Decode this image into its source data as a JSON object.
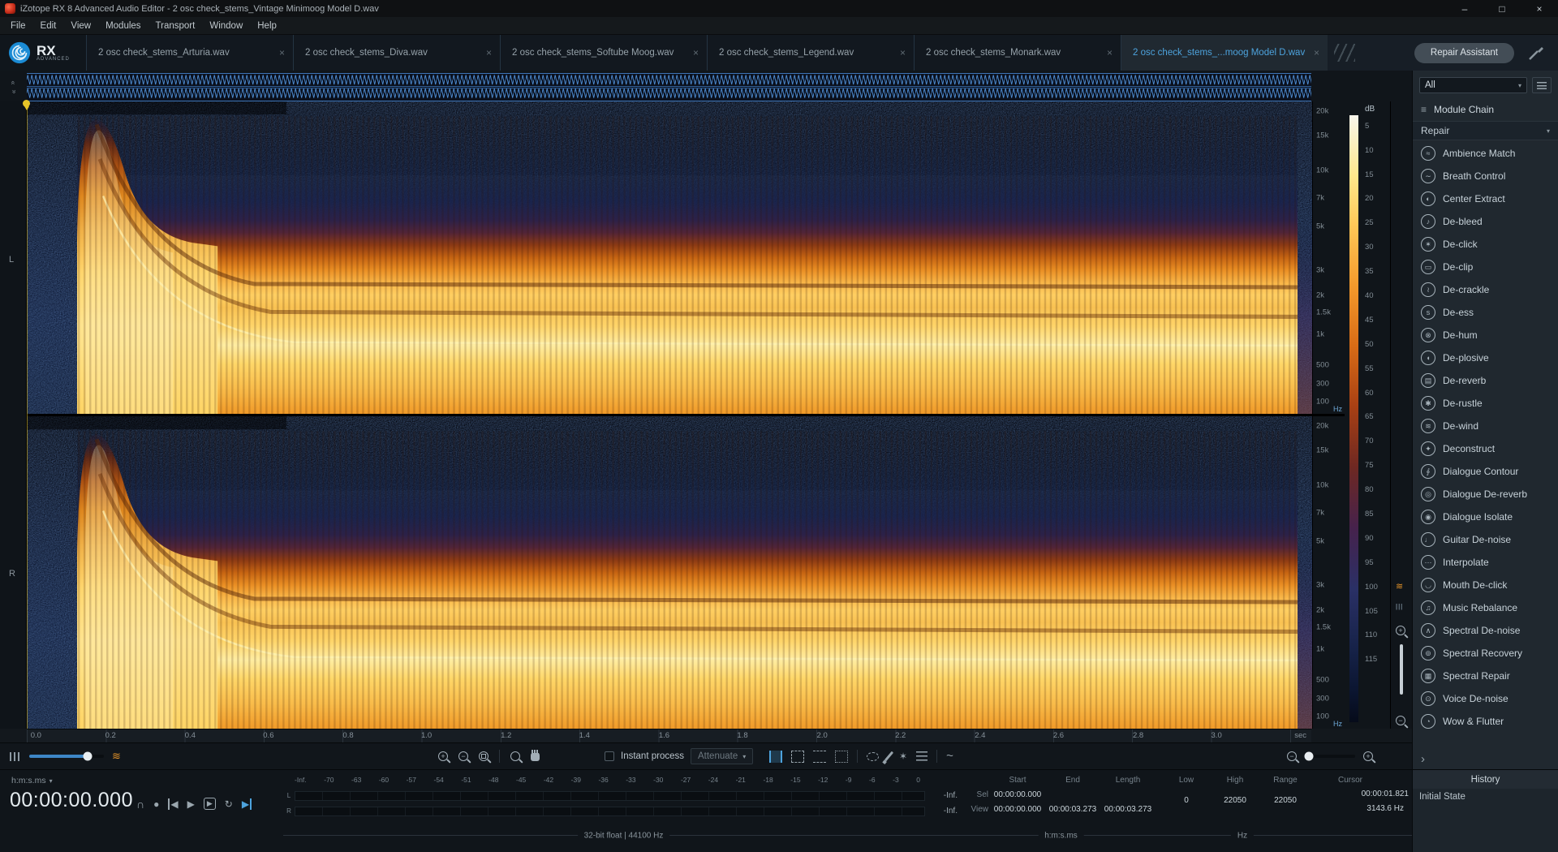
{
  "titlebar": {
    "title": "iZotope RX 8 Advanced Audio Editor - 2 osc check_stems_Vintage Minimoog Model D.wav",
    "minimize": "–",
    "maximize": "□",
    "close": "×"
  },
  "menubar": {
    "items": [
      "File",
      "Edit",
      "View",
      "Modules",
      "Transport",
      "Window",
      "Help"
    ]
  },
  "brand": {
    "product": "RX",
    "edition": "ADVANCED"
  },
  "tabbar": {
    "tabs": [
      {
        "label": "2 osc check_stems_Arturia.wav",
        "close": "×",
        "active": false
      },
      {
        "label": "2 osc check_stems_Diva.wav",
        "close": "×",
        "active": false
      },
      {
        "label": "2 osc check_stems_Softube Moog.wav",
        "close": "×",
        "active": false
      },
      {
        "label": "2 osc check_stems_Legend.wav",
        "close": "×",
        "active": false
      },
      {
        "label": "2 osc check_stems_Monark.wav",
        "close": "×",
        "active": false
      },
      {
        "label": "2 osc check_stems_...moog Model D.wav",
        "close": "×",
        "active": true
      }
    ],
    "repair_assistant": "Repair Assistant"
  },
  "spectrogram": {
    "channel_labels": [
      "L",
      "R"
    ],
    "freq_ticks": [
      "20k",
      "15k",
      "10k",
      "7k",
      "5k",
      "3k",
      "2k",
      "1.5k",
      "1k",
      "500",
      "300",
      "100"
    ],
    "freq_unit": "Hz",
    "db_unit": "dB",
    "db_ticks": [
      "5",
      "10",
      "15",
      "20",
      "25",
      "30",
      "35",
      "40",
      "45",
      "50",
      "55",
      "60",
      "65",
      "70",
      "75",
      "80",
      "85",
      "90",
      "95",
      "100",
      "105",
      "110",
      "115"
    ],
    "time_ticks": [
      "0.0",
      "0.2",
      "0.4",
      "0.6",
      "0.8",
      "1.0",
      "1.2",
      "1.4",
      "1.6",
      "1.8",
      "2.0",
      "2.2",
      "2.4",
      "2.6",
      "2.8",
      "3.0"
    ],
    "time_unit": "sec"
  },
  "toolbar": {
    "instant_process": "Instant process",
    "process_mode": "Attenuate"
  },
  "transport": {
    "time_format": "h:m:s.ms",
    "position": "00:00:00.000",
    "buttons": {
      "monitor": "∩",
      "record": "●",
      "to_start": "◀",
      "play": "▶",
      "play_special": "▶",
      "loop": "↻",
      "play_to_end": "▶"
    }
  },
  "meters": {
    "scale": [
      "-Inf.",
      "-70",
      "-63",
      "-60",
      "-57",
      "-54",
      "-51",
      "-48",
      "-45",
      "-42",
      "-39",
      "-36",
      "-33",
      "-30",
      "-27",
      "-24",
      "-21",
      "-18",
      "-15",
      "-12",
      "-9",
      "-6",
      "-3",
      "0"
    ],
    "left_label": "L",
    "right_label": "R",
    "left_peak": "-Inf.",
    "right_peak": "-Inf.",
    "format_info": "32-bit float | 44100 Hz"
  },
  "selection": {
    "col_start": "Start",
    "col_end": "End",
    "col_length": "Length",
    "sel_label": "Sel",
    "view_label": "View",
    "sel_start": "00:00:00.000",
    "sel_end": "",
    "sel_length": "",
    "view_start": "00:00:00.000",
    "view_end": "00:00:03.273",
    "view_length": "00:00:03.273",
    "unit": "h:m:s.ms"
  },
  "frequency": {
    "col_low": "Low",
    "col_high": "High",
    "col_range": "Range",
    "low": "0",
    "high": "22050",
    "range": "22050",
    "unit": "Hz"
  },
  "cursor": {
    "header": "Cursor",
    "time": "00:00:01.821",
    "freq": "3143.6 Hz"
  },
  "right_panel": {
    "filter": "All",
    "module_chain": "Module Chain",
    "category": "Repair",
    "modules": [
      {
        "icon": "ambience-match-icon",
        "glyph": "≈",
        "name": "Ambience Match"
      },
      {
        "icon": "breath-control-icon",
        "glyph": "∼",
        "name": "Breath Control"
      },
      {
        "icon": "center-extract-icon",
        "glyph": "◐",
        "name": "Center Extract"
      },
      {
        "icon": "de-bleed-icon",
        "glyph": "♪",
        "name": "De-bleed"
      },
      {
        "icon": "de-click-icon",
        "glyph": "✶",
        "name": "De-click"
      },
      {
        "icon": "de-clip-icon",
        "glyph": "▭",
        "name": "De-clip"
      },
      {
        "icon": "de-crackle-icon",
        "glyph": "≀",
        "name": "De-crackle"
      },
      {
        "icon": "de-ess-icon",
        "glyph": "s",
        "name": "De-ess"
      },
      {
        "icon": "de-hum-icon",
        "glyph": "⊗",
        "name": "De-hum"
      },
      {
        "icon": "de-plosive-icon",
        "glyph": "◖",
        "name": "De-plosive"
      },
      {
        "icon": "de-reverb-icon",
        "glyph": "▤",
        "name": "De-reverb"
      },
      {
        "icon": "de-rustle-icon",
        "glyph": "✱",
        "name": "De-rustle"
      },
      {
        "icon": "de-wind-icon",
        "glyph": "≋",
        "name": "De-wind"
      },
      {
        "icon": "deconstruct-icon",
        "glyph": "✦",
        "name": "Deconstruct"
      },
      {
        "icon": "dialogue-contour-icon",
        "glyph": "∮",
        "name": "Dialogue Contour"
      },
      {
        "icon": "dialogue-de-reverb-icon",
        "glyph": "◎",
        "name": "Dialogue De-reverb"
      },
      {
        "icon": "dialogue-isolate-icon",
        "glyph": "◉",
        "name": "Dialogue Isolate"
      },
      {
        "icon": "guitar-de-noise-icon",
        "glyph": "♩",
        "name": "Guitar De-noise"
      },
      {
        "icon": "interpolate-icon",
        "glyph": "⋯",
        "name": "Interpolate"
      },
      {
        "icon": "mouth-de-click-icon",
        "glyph": "◡",
        "name": "Mouth De-click"
      },
      {
        "icon": "music-rebalance-icon",
        "glyph": "♫",
        "name": "Music Rebalance"
      },
      {
        "icon": "spectral-de-noise-icon",
        "glyph": "∧",
        "name": "Spectral De-noise"
      },
      {
        "icon": "spectral-recovery-icon",
        "glyph": "⊚",
        "name": "Spectral Recovery"
      },
      {
        "icon": "spectral-repair-icon",
        "glyph": "▦",
        "name": "Spectral Repair"
      },
      {
        "icon": "voice-de-noise-icon",
        "glyph": "⊙",
        "name": "Voice De-noise"
      },
      {
        "icon": "wow-flutter-icon",
        "glyph": "◔",
        "name": "Wow & Flutter"
      }
    ],
    "history_title": "History",
    "history_items": [
      "Initial State"
    ]
  },
  "colors": {
    "accent_blue": "#4da3dd",
    "playhead_yellow": "#e6c428",
    "waveform_blue": "#4f8fd6",
    "spectrogram_hot": "#ffd768"
  }
}
